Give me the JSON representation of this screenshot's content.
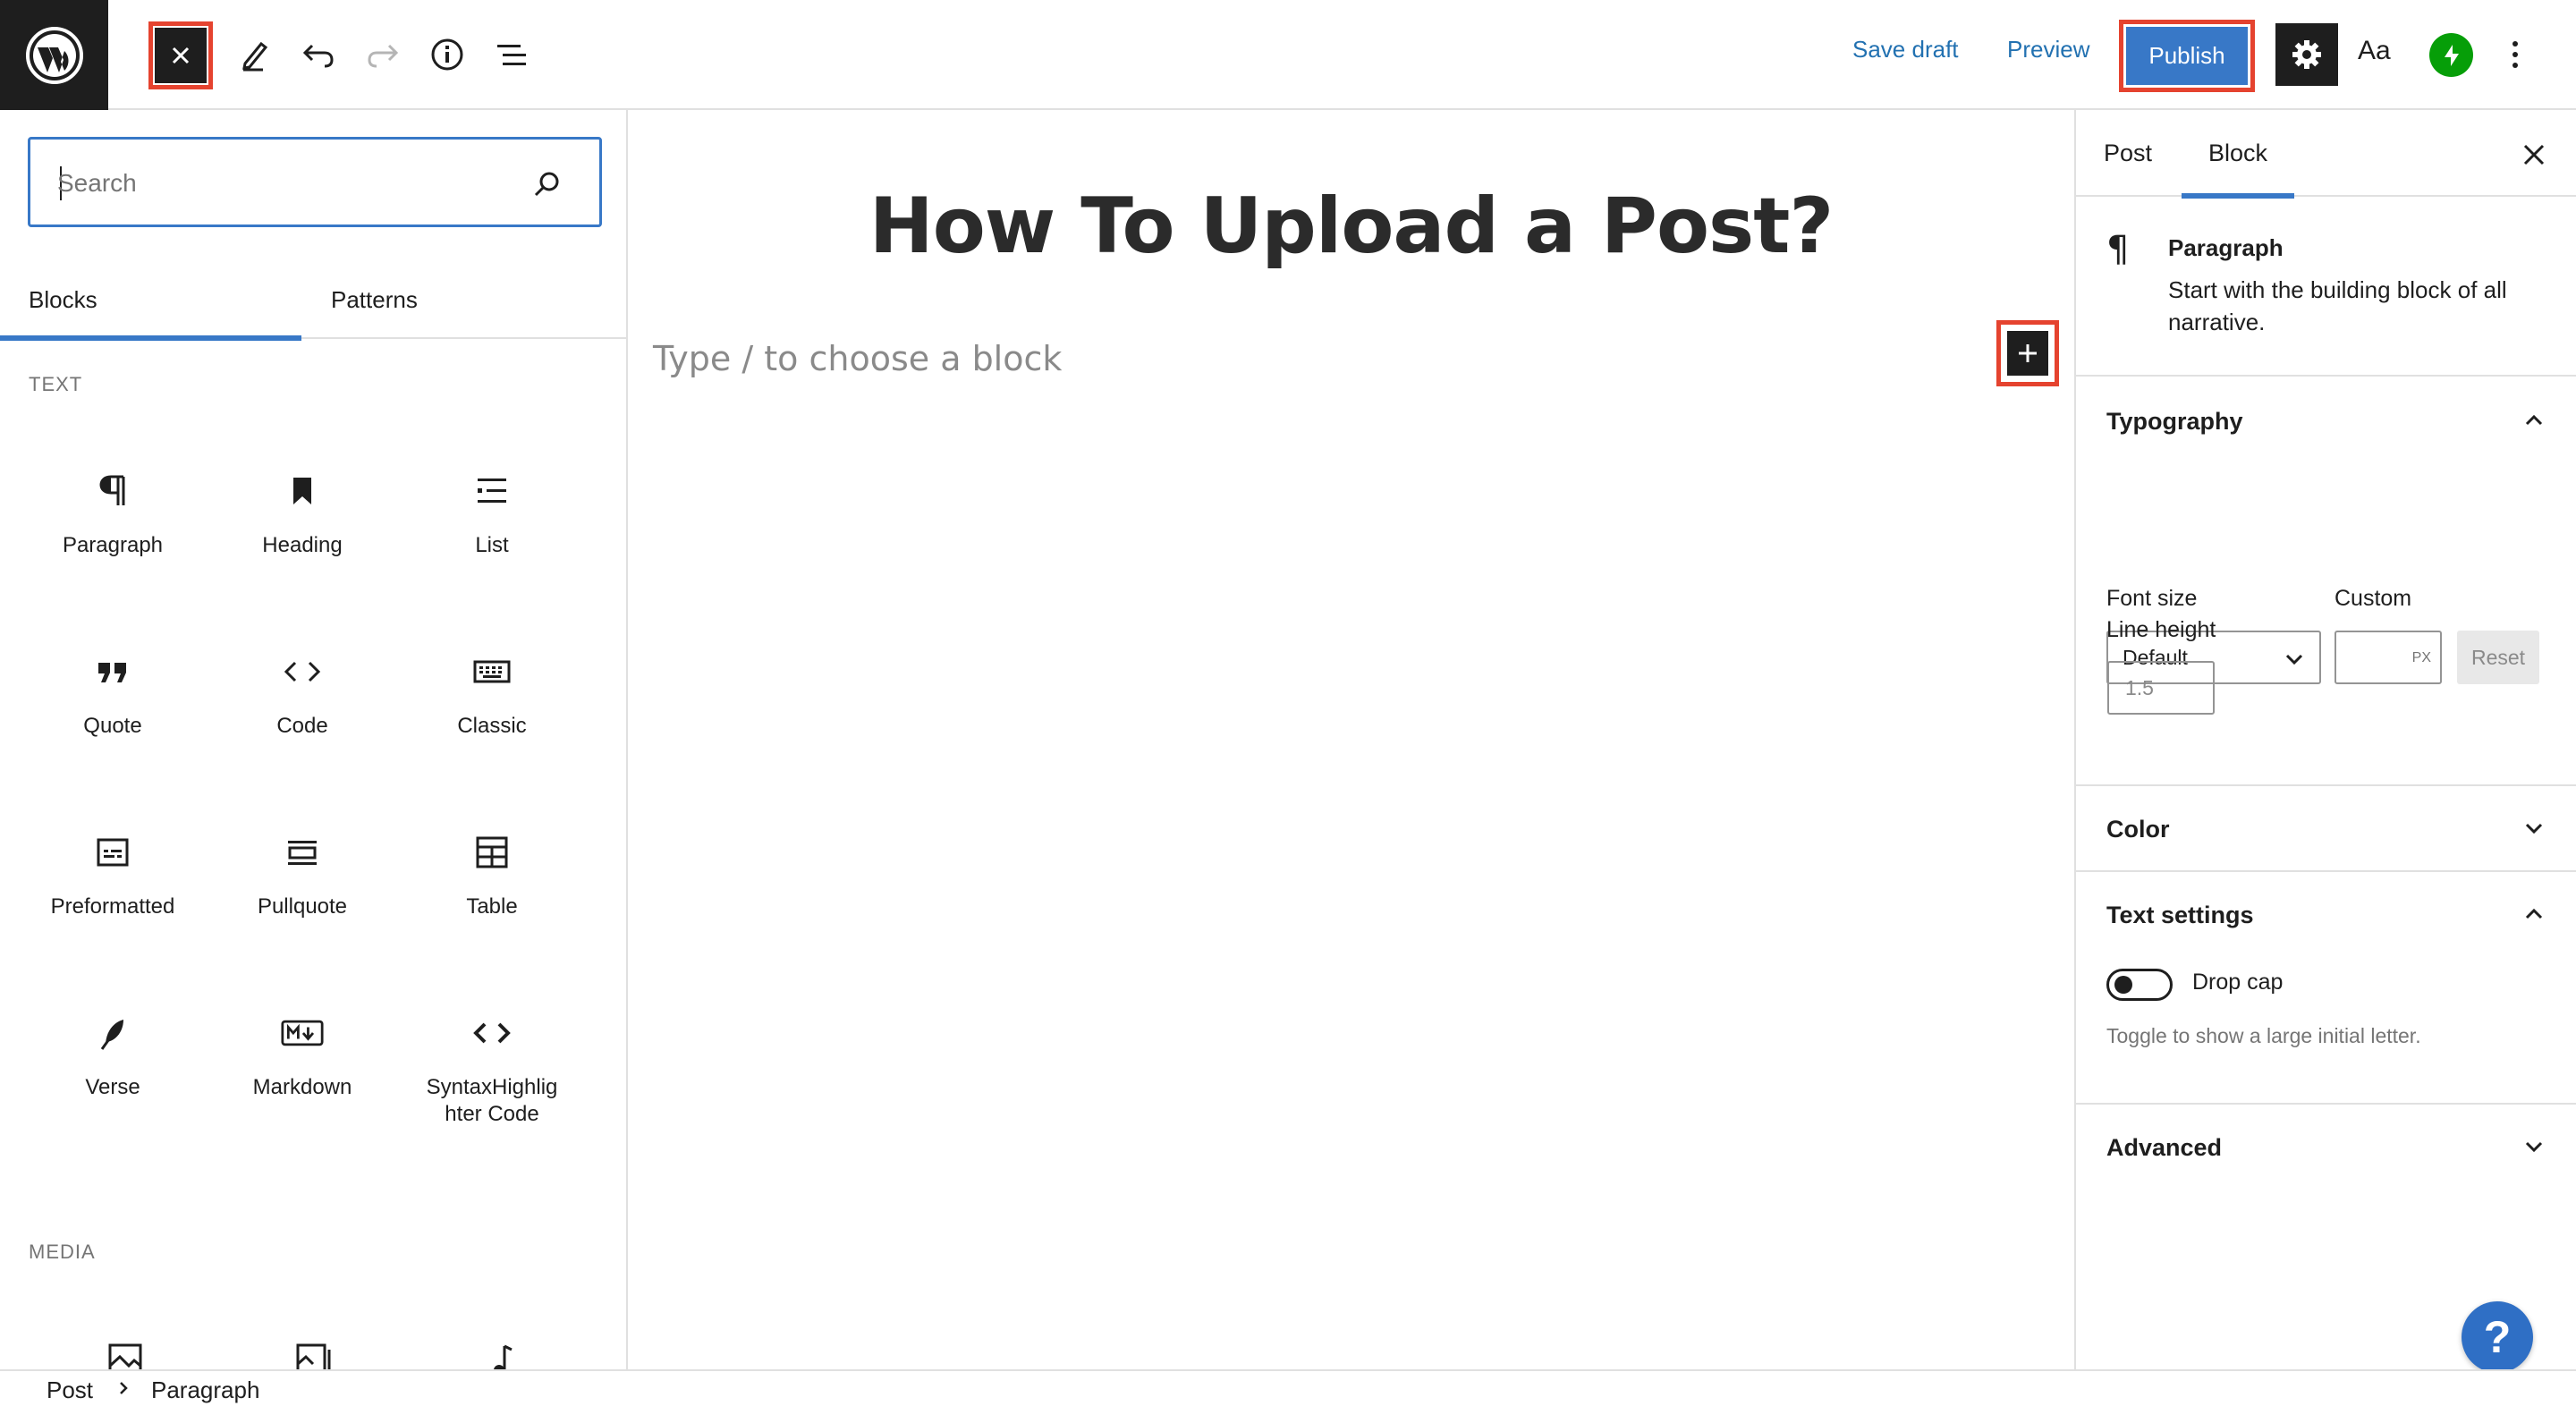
{
  "topbar": {
    "close_icon": "close-icon",
    "tools": [
      "pencil-icon",
      "undo-icon",
      "redo-icon",
      "info-icon",
      "list-view-icon"
    ],
    "save_draft": "Save draft",
    "preview": "Preview",
    "publish": "Publish",
    "styles_label": "Aa",
    "accent": "#3878c7",
    "highlight_color": "#e5432f"
  },
  "inserter": {
    "search_placeholder": "Search",
    "tabs": [
      {
        "label": "Blocks",
        "active": true
      },
      {
        "label": "Patterns",
        "active": false
      }
    ],
    "categories": [
      {
        "label": "TEXT",
        "blocks": [
          {
            "label": "Paragraph",
            "icon": "paragraph-icon"
          },
          {
            "label": "Heading",
            "icon": "bookmark-icon"
          },
          {
            "label": "List",
            "icon": "list-icon"
          },
          {
            "label": "Quote",
            "icon": "quote-icon"
          },
          {
            "label": "Code",
            "icon": "code-icon"
          },
          {
            "label": "Classic",
            "icon": "keyboard-icon"
          },
          {
            "label": "Preformatted",
            "icon": "preformatted-icon"
          },
          {
            "label": "Pullquote",
            "icon": "pullquote-icon"
          },
          {
            "label": "Table",
            "icon": "table-icon"
          },
          {
            "label": "Verse",
            "icon": "feather-icon"
          },
          {
            "label": "Markdown",
            "icon": "markdown-icon"
          },
          {
            "label": "SyntaxHighlighter Code",
            "icon": "code-icon"
          }
        ]
      },
      {
        "label": "MEDIA",
        "blocks": []
      }
    ]
  },
  "canvas": {
    "title": "How To Upload a Post?",
    "placeholder": "Type / to choose a block"
  },
  "sidebar": {
    "tabs": [
      {
        "label": "Post",
        "active": false
      },
      {
        "label": "Block",
        "active": true
      }
    ],
    "block_card": {
      "title": "Paragraph",
      "description": "Start with the building block of all narrative."
    },
    "typography": {
      "title": "Typography",
      "font_size_label": "Font size",
      "custom_label": "Custom",
      "font_size_value": "Default",
      "unit": "PX",
      "reset": "Reset",
      "line_height_label": "Line height",
      "line_height_placeholder": "1.5"
    },
    "color": {
      "title": "Color"
    },
    "text_settings": {
      "title": "Text settings",
      "drop_cap_label": "Drop cap",
      "drop_cap_enabled": false,
      "help": "Toggle to show a large initial letter."
    },
    "advanced": {
      "title": "Advanced"
    }
  },
  "footer": {
    "breadcrumbs": [
      "Post",
      "Paragraph"
    ]
  },
  "help_button": "?"
}
